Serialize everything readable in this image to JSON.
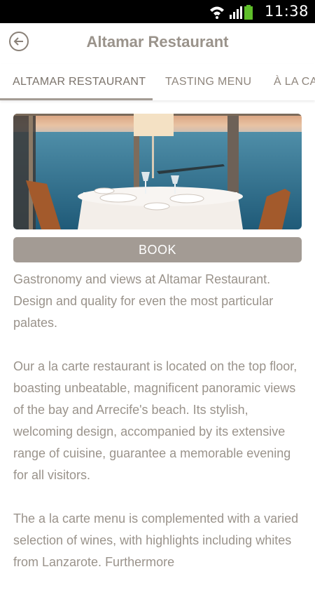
{
  "status_bar": {
    "time": "11:38",
    "icons": [
      "wifi-icon",
      "signal-icon",
      "battery-icon"
    ],
    "battery_color": "#5fbf2a"
  },
  "header": {
    "title": "Altamar Restaurant",
    "back_icon": "back-arrow-icon"
  },
  "tabs": [
    {
      "label": "ALTAMAR RESTAURANT",
      "active": true
    },
    {
      "label": "TASTING MENU",
      "active": false
    },
    {
      "label": "À LA CARTE",
      "active": false
    }
  ],
  "book_button": {
    "label": "BOOK"
  },
  "description": {
    "paragraphs": [
      "Gastronomy and views at Altamar Restaurant. Design and quality for even the most particular palates.",
      "Our a la carte restaurant is located on the top floor, boasting unbeatable, magnificent panoramic views of the bay and Arrecife's beach. Its stylish, welcoming design, accompanied by its extensive range of cuisine, guarantee a memorable evening for all visitors.",
      "The a la carte menu is complemented with a varied selection of wines, with highlights including whites from Lanzarote. Furthermore"
    ]
  },
  "colors": {
    "accent": "#a39b94",
    "text": "#9a938b",
    "status_bar": "#000000"
  }
}
